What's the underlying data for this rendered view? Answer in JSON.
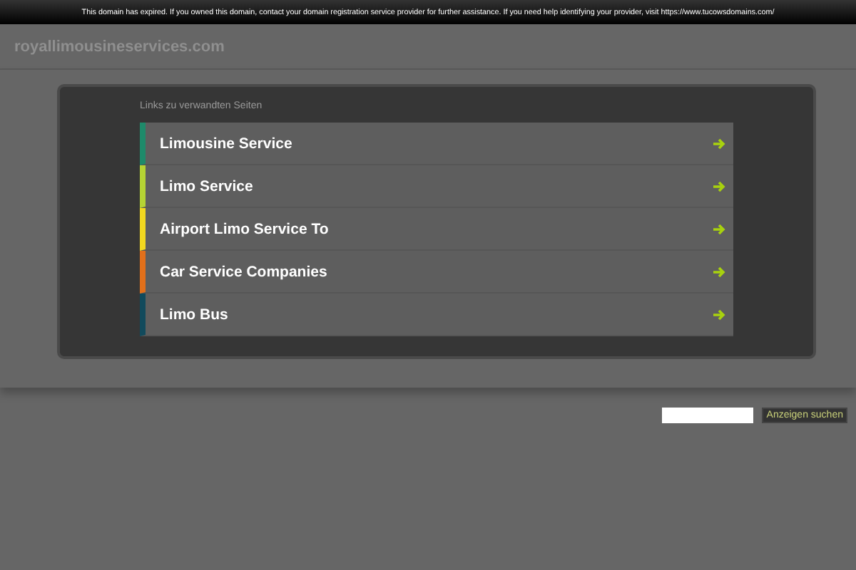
{
  "notice": "This domain has expired. If you owned this domain, contact your domain registration service provider for further assistance. If you need help identifying your provider, visit https://www.tucowsdomains.com/",
  "domain": "royallimousineservices.com",
  "related": {
    "heading": "Links zu verwandten Seiten",
    "links": [
      {
        "label": "Limousine Service",
        "color": "#1e8a6a"
      },
      {
        "label": "Limo Service",
        "color": "#b5d334"
      },
      {
        "label": "Airport Limo Service To",
        "color": "#f2d81f"
      },
      {
        "label": "Car Service Companies",
        "color": "#e2701b"
      },
      {
        "label": "Limo Bus",
        "color": "#114a5c"
      }
    ]
  },
  "search": {
    "button": "Anzeigen suchen"
  }
}
